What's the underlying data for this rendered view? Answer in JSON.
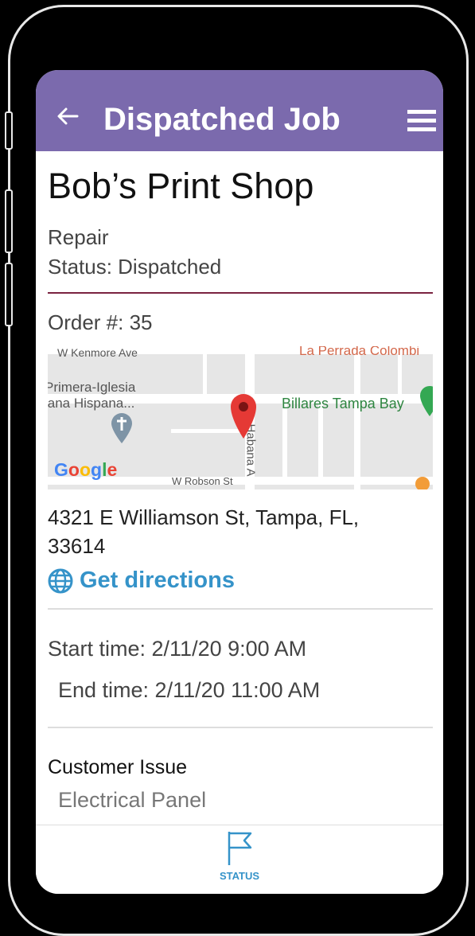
{
  "header": {
    "title": "Dispatched Job",
    "back_icon": "arrow-left-icon",
    "menu_icon": "hamburger-menu-icon"
  },
  "job": {
    "customer": "Bob’s Print Shop",
    "type": "Repair",
    "status": "Status: Dispatched",
    "order": "Order #: 35",
    "address_line1": "4321 E Williamson St, Tampa, FL,",
    "address_line2": "33614",
    "directions_label": "Get directions",
    "start_time": "Start time: 2/11/20 9:00 AM",
    "end_time": "End time: 2/11/20 11:00 AM",
    "issue_label": "Customer Issue",
    "issue_value": "Electrical Panel"
  },
  "map": {
    "labels": {
      "kenmore": "W Kenmore Ave",
      "perrada": "La Perrada Colombi",
      "iglesia1": "Primera-Iglesia",
      "iglesia2": "iana Hispana...",
      "billares": "Billares Tampa Bay",
      "habana": "Habana A",
      "robson": "W Robson St",
      "google": "Google"
    },
    "colors": {
      "pin": "#e53935",
      "green_pin": "#34a853",
      "church": "#7e94a6"
    }
  },
  "bottom_nav": {
    "status_label": "STATUS",
    "icon": "flag-icon"
  },
  "colors": {
    "appbar": "#7b6aad",
    "accent": "#3593c9",
    "divider_red": "#7a2341"
  }
}
